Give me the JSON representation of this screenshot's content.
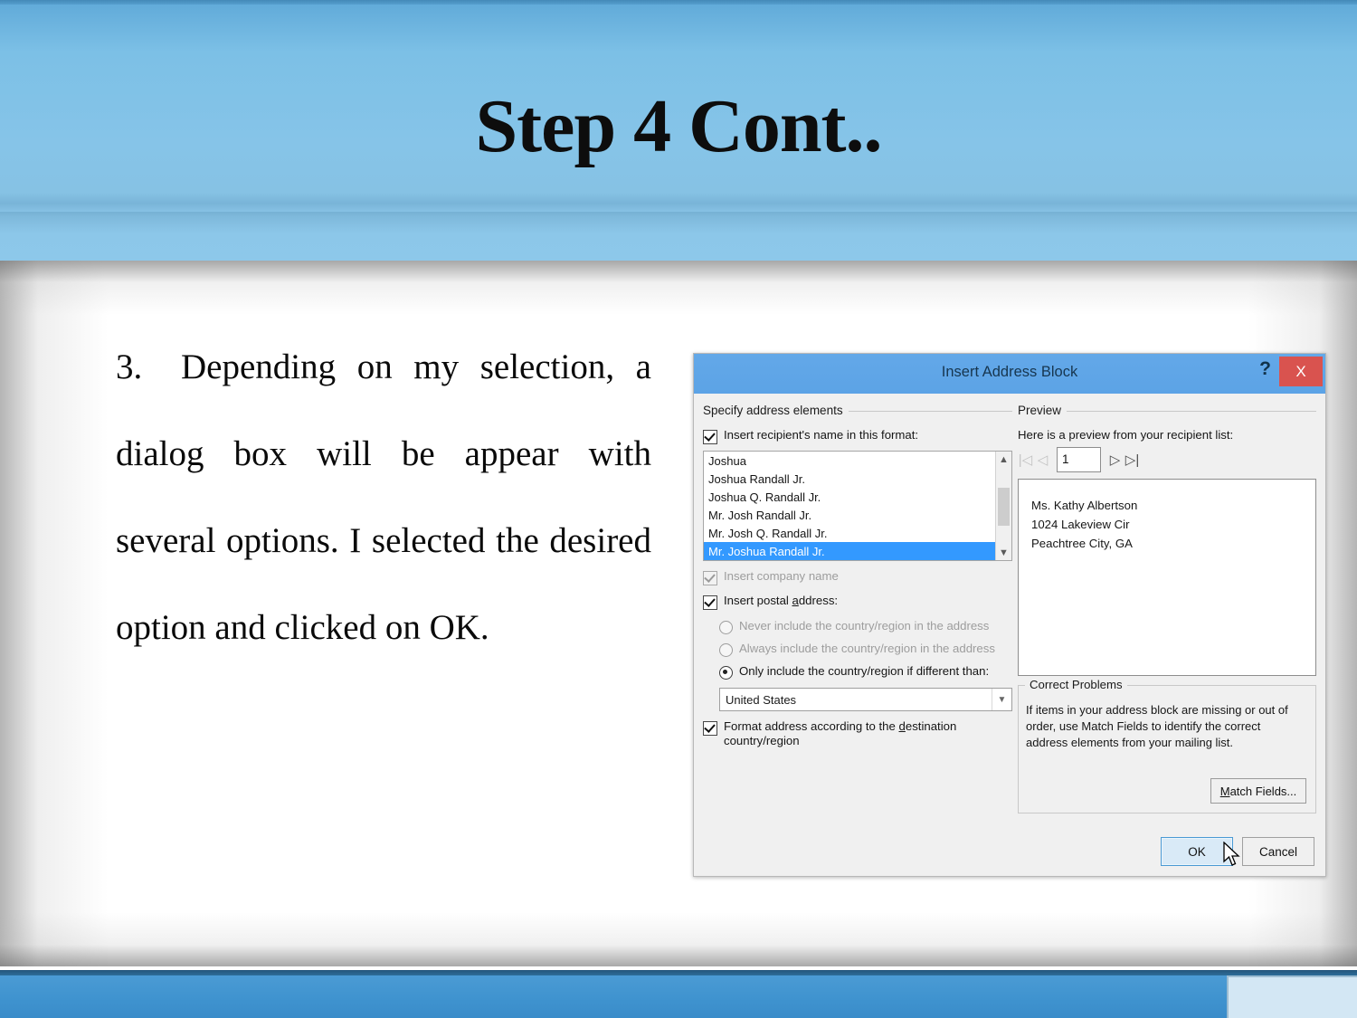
{
  "slide": {
    "title": "Step 4 Cont..",
    "body_number": "3.",
    "body_text": "Depending on my selection, a dialog box will be appear with several options. I selected the desired option and clicked on OK."
  },
  "theme": {
    "banner_blue": "#86c4e8",
    "footer_blue": "#3f93cf",
    "footer_box": "#d3e7f4",
    "selection_blue": "#3399ff",
    "close_red": "#d9534f",
    "dialog_title_blue": "#5ca3e6"
  },
  "dialog": {
    "title": "Insert Address Block",
    "help_glyph": "?",
    "close_glyph": "X",
    "left": {
      "group_label": "Specify address elements",
      "insert_name_label": "Insert recipient's name in this format:",
      "insert_name_checked": true,
      "name_formats": [
        "Joshua",
        "Joshua Randall Jr.",
        "Joshua Q. Randall Jr.",
        "Mr. Josh Randall Jr.",
        "Mr. Josh Q. Randall Jr.",
        "Mr. Joshua Randall Jr."
      ],
      "selected_format": "Mr. Joshua Randall Jr.",
      "insert_company_label": "Insert company name",
      "insert_company_checked": true,
      "insert_company_enabled": false,
      "insert_postal_label_a": "Insert postal ",
      "insert_postal_label_b": "a",
      "insert_postal_label_c": "ddress:",
      "insert_postal_checked": true,
      "radio_never": "Never include the country/region in the address",
      "radio_always": "Always include the country/region in the address",
      "radio_only": "Only include the country/region if different than:",
      "radio_selected": "only",
      "country_value": "United States",
      "format_address_label_a": "Format address according to the ",
      "format_address_label_b": "d",
      "format_address_label_c": "estination country/region",
      "format_address_checked": true
    },
    "right": {
      "group_label": "Preview",
      "preview_intro": "Here is a preview from your recipient list:",
      "record_number": "1",
      "nav_first": "|◁",
      "nav_prev": "◁",
      "nav_next": "▷",
      "nav_last": "▷|",
      "preview_lines": [
        "Ms. Kathy Albertson",
        "1024 Lakeview Cir",
        "Peachtree City, GA"
      ],
      "correct_problems_title": "Correct Problems",
      "correct_problems_text": "If items in your address block are missing or out of order, use Match Fields to identify the correct address elements from your mailing list.",
      "match_fields_label_a": "M",
      "match_fields_label_b": "atch Fields...",
      "ok_label": "OK",
      "cancel_label": "Cancel"
    }
  }
}
